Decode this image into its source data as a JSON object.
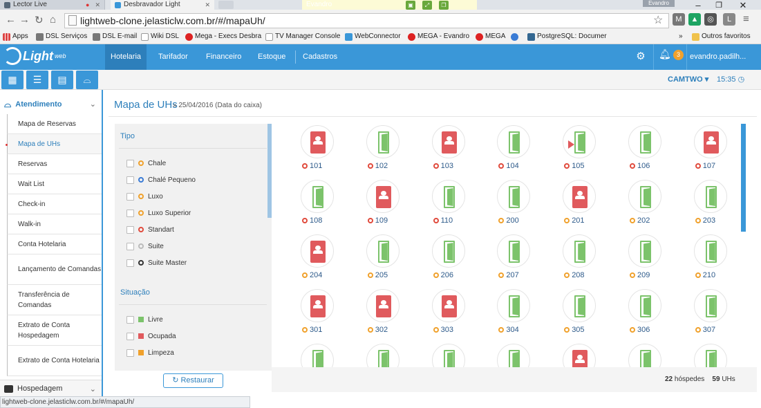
{
  "browser": {
    "tabs": [
      {
        "label": "Lector Live"
      },
      {
        "label": "Desbravador Light"
      }
    ],
    "float_title": "Evandro",
    "profile": "Evandro",
    "url": "lightweb-clone.jelasticlw.com.br/#/mapaUh/",
    "status_url": "lightweb-clone.jelasticlw.com.br/#/mapaUh/",
    "bookmarks": [
      "Apps",
      "DSL Serviços",
      "DSL E-mail",
      "Wiki DSL",
      "Mega - Execs Desbra",
      "TV Manager Console",
      "WebConnector",
      "MEGA - Evandro",
      "MEGA",
      "PostgreSQL: Documer"
    ],
    "bookmarks_more": "»",
    "other_bookmarks": "Outros favoritos"
  },
  "app": {
    "logo": "Light",
    "logo_sub": "web",
    "nav": [
      "Hotelaria",
      "Tarifador",
      "Financeiro",
      "Estoque",
      "Cadastros"
    ],
    "notifications": "3",
    "user": "evandro.padilh..."
  },
  "toolbar": {
    "property": "CAMTWO",
    "time": "15:35"
  },
  "sidebar": {
    "section": "Atendimento",
    "items": [
      "Mapa de Reservas",
      "Mapa de UHs",
      "Reservas",
      "Wait List",
      "Check-in",
      "Walk-in",
      "Conta Hotelaria",
      "Lançamento de Comandas",
      "Transferência de Comandas",
      "Extrato de Conta Hospedagem",
      "Extrato de Conta Hotelaria"
    ],
    "active": "Mapa de UHs",
    "bottom_section": "Hospedagem"
  },
  "main": {
    "title": "Mapa de UHs",
    "subtitle": "» 25/04/2016 (Data do caixa)",
    "filter_tipo_label": "Tipo",
    "tipo": [
      {
        "label": "Chale",
        "color": "#f0a12c"
      },
      {
        "label": "Chalé Pequeno",
        "color": "#3a7bd5"
      },
      {
        "label": "Luxo",
        "color": "#f0a12c"
      },
      {
        "label": "Luxo Superior",
        "color": "#f0a12c"
      },
      {
        "label": "Standart",
        "color": "#e04a3c"
      },
      {
        "label": "Suite",
        "color": "#bbbbbb"
      },
      {
        "label": "Suite Master",
        "color": "#333333"
      }
    ],
    "filter_situacao_label": "Situação",
    "situacao": [
      {
        "label": "Livre",
        "color": "#7cc36b"
      },
      {
        "label": "Ocupada",
        "color": "#e05a5d"
      },
      {
        "label": "Limpeza",
        "color": "#f0a12c"
      }
    ],
    "restore_label": "Restaurar",
    "rooms": [
      {
        "num": "101",
        "occ": true,
        "st": "r"
      },
      {
        "num": "102",
        "occ": false,
        "st": "r"
      },
      {
        "num": "103",
        "occ": true,
        "st": "r"
      },
      {
        "num": "104",
        "occ": false,
        "st": "r"
      },
      {
        "num": "105",
        "occ": false,
        "st": "r",
        "flag": true
      },
      {
        "num": "106",
        "occ": false,
        "st": "r"
      },
      {
        "num": "107",
        "occ": true,
        "st": "r"
      },
      {
        "num": "108",
        "occ": false,
        "st": "r"
      },
      {
        "num": "109",
        "occ": true,
        "st": "r"
      },
      {
        "num": "110",
        "occ": false,
        "st": "r"
      },
      {
        "num": "200",
        "occ": false,
        "st": "o"
      },
      {
        "num": "201",
        "occ": true,
        "st": "o"
      },
      {
        "num": "202",
        "occ": false,
        "st": "o"
      },
      {
        "num": "203",
        "occ": false,
        "st": "o"
      },
      {
        "num": "204",
        "occ": true,
        "st": "o"
      },
      {
        "num": "205",
        "occ": false,
        "st": "o"
      },
      {
        "num": "206",
        "occ": false,
        "st": "o"
      },
      {
        "num": "207",
        "occ": false,
        "st": "o"
      },
      {
        "num": "208",
        "occ": false,
        "st": "o"
      },
      {
        "num": "209",
        "occ": false,
        "st": "o"
      },
      {
        "num": "210",
        "occ": false,
        "st": "o"
      },
      {
        "num": "301",
        "occ": true,
        "st": "o"
      },
      {
        "num": "302",
        "occ": true,
        "st": "o"
      },
      {
        "num": "303",
        "occ": true,
        "st": "o"
      },
      {
        "num": "304",
        "occ": false,
        "st": "o"
      },
      {
        "num": "305",
        "occ": false,
        "st": "o"
      },
      {
        "num": "306",
        "occ": false,
        "st": "o"
      },
      {
        "num": "307",
        "occ": false,
        "st": "o"
      },
      {
        "num": "",
        "occ": false,
        "st": ""
      },
      {
        "num": "",
        "occ": false,
        "st": ""
      },
      {
        "num": "",
        "occ": false,
        "st": ""
      },
      {
        "num": "",
        "occ": false,
        "st": ""
      },
      {
        "num": "",
        "occ": true,
        "st": ""
      },
      {
        "num": "",
        "occ": false,
        "st": ""
      },
      {
        "num": "",
        "occ": false,
        "st": ""
      }
    ],
    "guests": "22",
    "guests_label": "hóspedes",
    "units": "59",
    "units_label": "UHs"
  }
}
